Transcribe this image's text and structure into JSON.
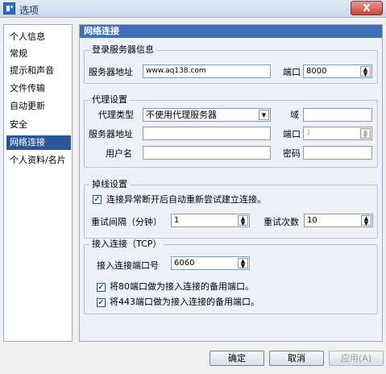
{
  "window": {
    "title": "选项",
    "close_label": "X"
  },
  "sidebar": {
    "items": [
      {
        "label": "个人信息"
      },
      {
        "label": "常规"
      },
      {
        "label": "提示和声音"
      },
      {
        "label": "文件传输"
      },
      {
        "label": "自动更新"
      },
      {
        "label": "安全"
      },
      {
        "label": "网络连接",
        "selected": true
      },
      {
        "label": "个人资料/名片"
      }
    ]
  },
  "panel": {
    "header": "网络连接",
    "login_server": {
      "title": "登录服务器信息",
      "address_label": "服务器地址",
      "address_value": "www.aq138.com",
      "port_label": "端口",
      "port_value": "8000"
    },
    "proxy": {
      "title": "代理设置",
      "type_label": "代理类型",
      "type_value": "不使用代理服务器",
      "domain_label": "域",
      "domain_value": "",
      "server_label": "服务器地址",
      "server_value": "",
      "port_label": "端口",
      "port_value": "1",
      "username_label": "用户名",
      "username_value": "",
      "password_label": "密码",
      "password_value": ""
    },
    "disconnect": {
      "title": "掉线设置",
      "auto_reconnect_label": "连接异常断开后自动重新尝试建立连接。",
      "auto_reconnect_checked": true,
      "interval_label": "重试间隔（分钟）",
      "interval_value": "1",
      "retries_label": "重试次数",
      "retries_value": "10"
    },
    "incoming": {
      "title": "接入连接（TCP）",
      "port_label": "接入连接端口号",
      "port_value": "6060",
      "use80_label": "将80端口做为接入连接的备用端口。",
      "use80_checked": true,
      "use443_label": "将443端口做为接入连接的备用端口。",
      "use443_checked": true
    }
  },
  "buttons": {
    "ok": "确定",
    "cancel": "取消",
    "apply": "应用(A)"
  },
  "colors": {
    "selection": "#2b5798",
    "header": "#3f6fb5"
  }
}
